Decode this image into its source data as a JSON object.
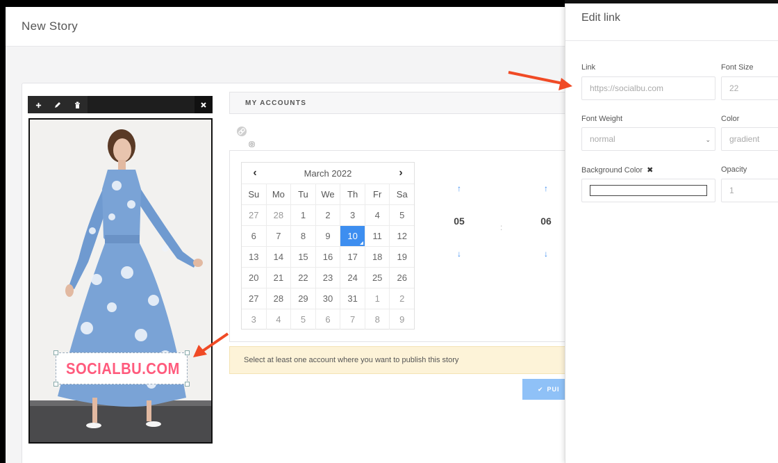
{
  "page": {
    "title": "New Story"
  },
  "toolbar": {
    "icons": [
      "plus-icon",
      "pencil-icon",
      "trash-icon",
      "close-icon"
    ]
  },
  "sticker": {
    "text": "SOCIALBU.COM",
    "color": "#ff5b7d"
  },
  "accounts": {
    "label": "MY ACCOUNTS"
  },
  "calendar": {
    "month_label": "March 2022",
    "weekdays": [
      "Su",
      "Mo",
      "Tu",
      "We",
      "Th",
      "Fr",
      "Sa"
    ],
    "weeks": [
      [
        "27",
        "28",
        "1",
        "2",
        "3",
        "4",
        "5"
      ],
      [
        "6",
        "7",
        "8",
        "9",
        "10",
        "11",
        "12"
      ],
      [
        "13",
        "14",
        "15",
        "16",
        "17",
        "18",
        "19"
      ],
      [
        "20",
        "21",
        "22",
        "23",
        "24",
        "25",
        "26"
      ],
      [
        "27",
        "28",
        "29",
        "30",
        "31",
        "1",
        "2"
      ],
      [
        "3",
        "4",
        "5",
        "6",
        "7",
        "8",
        "9"
      ]
    ],
    "selected": "10",
    "accent": "#3d8ef0"
  },
  "time": {
    "hours": "05",
    "separator": ":",
    "minutes": "06"
  },
  "notice": {
    "text": "Select at least one account where you want to publish this story"
  },
  "publish": {
    "label": "PUI"
  },
  "panel": {
    "title": "Edit link",
    "link_label": "Link",
    "link_placeholder": "https://socialbu.com",
    "font_size_label": "Font Size",
    "font_size_value": "22",
    "font_weight_label": "Font Weight",
    "font_weight_value": "normal",
    "color_label": "Color",
    "color_value": "gradient",
    "bg_color_label": "Background Color",
    "opacity_label": "Opacity",
    "opacity_value": "1"
  }
}
